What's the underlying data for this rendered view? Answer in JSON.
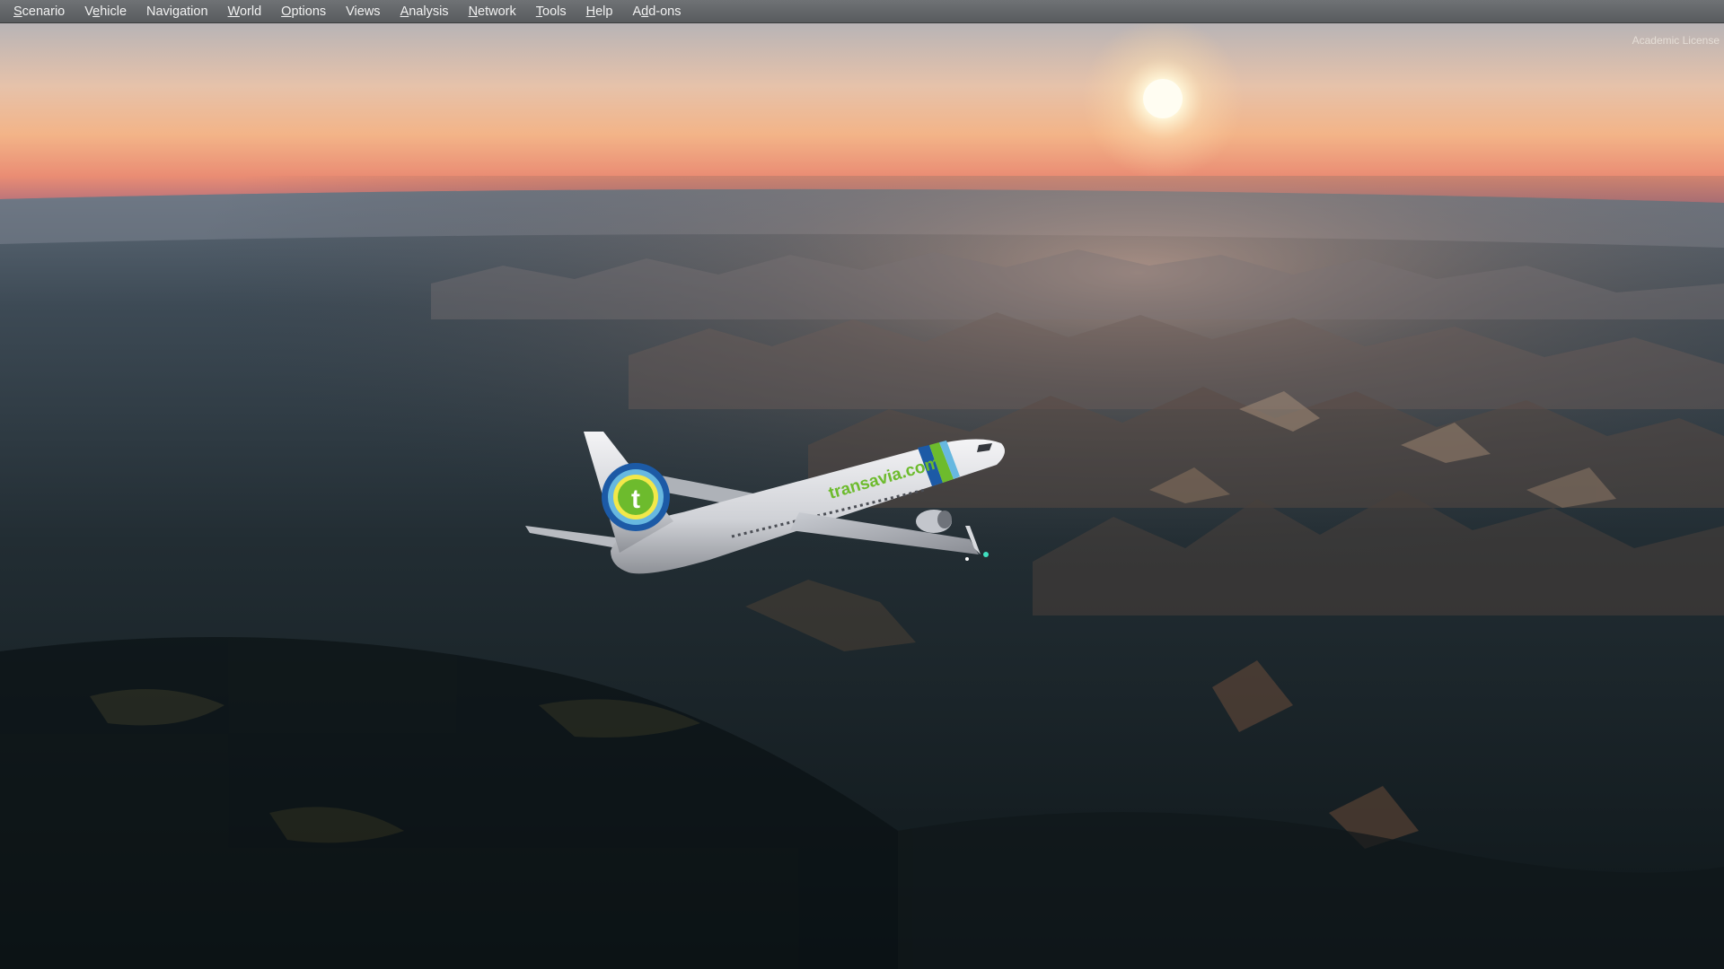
{
  "menu": {
    "items": [
      {
        "label": "Scenario",
        "mnemonic_index": 0
      },
      {
        "label": "Vehicle",
        "mnemonic_index": 1
      },
      {
        "label": "Navigation",
        "mnemonic_index": -1
      },
      {
        "label": "World",
        "mnemonic_index": 0
      },
      {
        "label": "Options",
        "mnemonic_index": 0
      },
      {
        "label": "Views",
        "mnemonic_index": -1
      },
      {
        "label": "Analysis",
        "mnemonic_index": 0
      },
      {
        "label": "Network",
        "mnemonic_index": 0
      },
      {
        "label": "Tools",
        "mnemonic_index": 0
      },
      {
        "label": "Help",
        "mnemonic_index": 0
      },
      {
        "label": "Add-ons",
        "mnemonic_index": 1
      }
    ]
  },
  "overlay": {
    "license_text": "Academic License"
  },
  "aircraft": {
    "livery_text": "transavia.com",
    "tail_letter": "t"
  },
  "colors": {
    "menubar": "#636669",
    "sky_top": "#b9b3b3",
    "sky_horizon": "#e9866f",
    "sun": "#fffbe8",
    "terrain_dark": "#11191c",
    "livery_green": "#6dbb2d",
    "livery_blue": "#1c5aa6"
  }
}
